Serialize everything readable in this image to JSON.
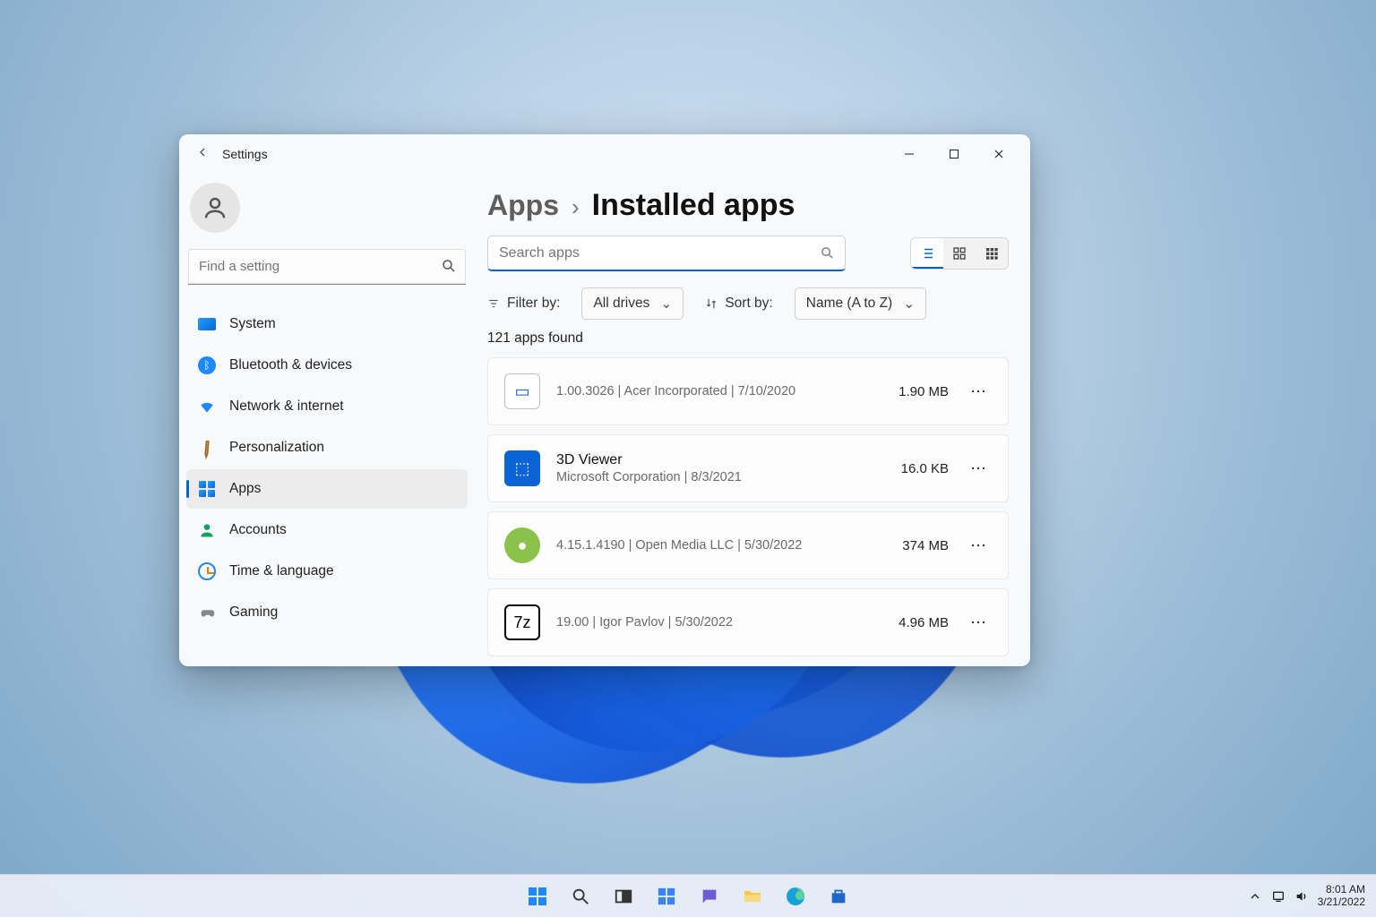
{
  "window": {
    "title": "Settings"
  },
  "sidebar": {
    "find_placeholder": "Find a setting",
    "items": [
      {
        "label": "System"
      },
      {
        "label": "Bluetooth & devices"
      },
      {
        "label": "Network & internet"
      },
      {
        "label": "Personalization"
      },
      {
        "label": "Apps"
      },
      {
        "label": "Accounts"
      },
      {
        "label": "Time & language"
      },
      {
        "label": "Gaming"
      }
    ]
  },
  "breadcrumb": {
    "root": "Apps",
    "leaf": "Installed apps"
  },
  "search": {
    "placeholder": "Search apps"
  },
  "filter": {
    "label": "Filter by:",
    "value": "All drives"
  },
  "sort": {
    "label": "Sort by:",
    "value": "Name (A to Z)"
  },
  "count": "121 apps found",
  "apps": [
    {
      "name": "",
      "meta": "1.00.3026   |   Acer Incorporated   |   7/10/2020",
      "size": "1.90 MB",
      "icon_bg": "#ffffff",
      "icon_text": "▭",
      "icon_fg": "#0b63d6",
      "border": "1px solid #c0c0c0"
    },
    {
      "name": "3D Viewer",
      "meta": "Microsoft Corporation   |   8/3/2021",
      "size": "16.0 KB",
      "icon_bg": "#0b63d6",
      "icon_text": "⬚",
      "icon_fg": "#fff"
    },
    {
      "name": "",
      "meta": "4.15.1.4190   |   Open Media LLC   |   5/30/2022",
      "size": "374 MB",
      "icon_bg": "#8bc34a",
      "icon_text": "●",
      "icon_fg": "#fff",
      "round": "50%"
    },
    {
      "name": "",
      "meta": "19.00   |   Igor Pavlov   |   5/30/2022",
      "size": "4.96 MB",
      "icon_bg": "#ffffff",
      "icon_text": "7z",
      "icon_fg": "#000",
      "border": "2px solid #000"
    }
  ],
  "tray": {
    "time": "8:01 AM",
    "date": "3/21/2022"
  }
}
